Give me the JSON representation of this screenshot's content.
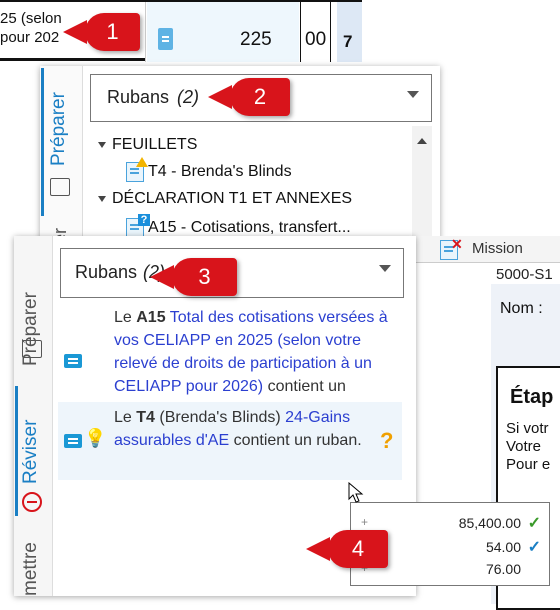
{
  "top_row": {
    "line1": "25 (selon",
    "line2": "pour 202",
    "amount": "225",
    "cents": "00",
    "line_number": "7"
  },
  "callouts": [
    "1",
    "2",
    "3",
    "4"
  ],
  "panel_top": {
    "tab_label": "Préparer",
    "dropdown_label": "Rubans",
    "dropdown_count": "(2)",
    "tree": [
      {
        "label": "FEUILLETS"
      },
      {
        "label": "T4 - Brenda's Blinds"
      },
      {
        "label": "DÉCLARATION T1 ET ANNEXES"
      },
      {
        "label": "A15 - Cotisations, transfert..."
      }
    ],
    "partial_tab": "er"
  },
  "panel_main": {
    "tabs": [
      {
        "label": "Préparer"
      },
      {
        "label": "Réviser"
      },
      {
        "label": "mettre"
      }
    ],
    "dropdown_label": "Rubans",
    "dropdown_count": "(2)",
    "ruban1": {
      "prefix": "Le",
      "code": "A15",
      "text": "Total des cotisations versées à vos CELIAPP en 2025 (selon votre relevé de droits de participation à un CELIAPP pour 2026)",
      "suffix": "contient un ruban."
    },
    "ruban2": {
      "prefix": "Le",
      "code": "T4",
      "owner": "(Brenda's Blinds)",
      "link": "24-Gains assurables d'AE",
      "suffix": "contient un ruban.",
      "help": "?"
    }
  },
  "right_doc": {
    "mission": "Mission",
    "code": "5000-S1",
    "nom": "Nom :",
    "etape": "Étap",
    "lines": [
      "Si votr",
      "Votre",
      "Pour e"
    ]
  },
  "popup": {
    "rows": [
      {
        "sign": "+",
        "value": "85,400.00",
        "check": "✓",
        "check_color": "#3a9a2a"
      },
      {
        "sign": "+",
        "value": "54.00",
        "check": "✓",
        "check_color": "#1a7fc4"
      },
      {
        "sign": "+",
        "value": "76.00",
        "check": "",
        "check_color": "#000000"
      }
    ]
  },
  "colors": {
    "callout": "#d8141b",
    "accent": "#1a7fc4",
    "link": "#2b3fd0"
  }
}
